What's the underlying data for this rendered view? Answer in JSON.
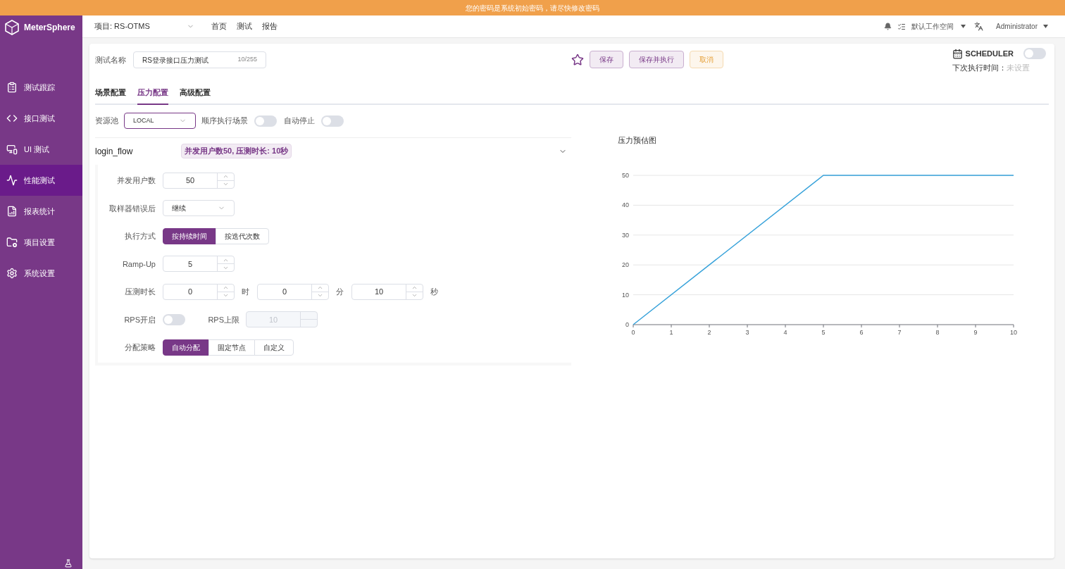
{
  "banner": {
    "text": "您的密码是系统初始密码，请尽快修改密码"
  },
  "sidebar": {
    "logo": "MeterSphere",
    "items": [
      {
        "kind": "track",
        "label": "测试跟踪",
        "selected": false
      },
      {
        "kind": "api",
        "label": "接口测试",
        "selected": false
      },
      {
        "kind": "ui",
        "label": "UI 测试",
        "selected": false
      },
      {
        "kind": "performance",
        "label": "性能测试",
        "selected": true
      },
      {
        "kind": "report",
        "label": "报表统计",
        "selected": false
      },
      {
        "kind": "project",
        "label": "项目设置",
        "selected": false
      },
      {
        "kind": "system",
        "label": "系统设置",
        "selected": false
      }
    ]
  },
  "header": {
    "project": "项目: RS-OTMS",
    "nav": [
      "首页",
      "测试",
      "报告"
    ],
    "workspace": "默认工作空间",
    "user": "Administrator"
  },
  "test": {
    "name_label": "测试名称",
    "name_value": "RS登录接口压力测试",
    "counter": "10/255",
    "starred": false,
    "buttons": [
      {
        "kind": "primary",
        "label": "保存"
      },
      {
        "kind": "primary",
        "label": "保存并执行"
      },
      {
        "kind": "warning",
        "label": "取消"
      }
    ]
  },
  "scheduler": {
    "label": "SCHEDULER",
    "on": false,
    "next_label": "下次执行时间：",
    "next_value": "未设置"
  },
  "tabs": [
    {
      "label": "场景配置",
      "selected": false
    },
    {
      "label": "压力配置",
      "selected": true
    },
    {
      "label": "高级配置",
      "selected": false
    }
  ],
  "pool": {
    "label": "资源池",
    "value": "LOCAL",
    "toggles": [
      {
        "label": "顺序执行场景",
        "on": false
      },
      {
        "label": "自动停止",
        "on": false
      }
    ]
  },
  "scenario": {
    "name": "login_flow",
    "summary": "并发用户数50, 压测时长: 10秒",
    "fields": [
      {
        "kind": "number",
        "label": "并发用户数",
        "value": "50"
      },
      {
        "kind": "select",
        "label": "取样器错误后",
        "value": "继续"
      },
      {
        "kind": "segmented",
        "label": "执行方式",
        "options": [
          {
            "label": "按持续时间",
            "selected": true
          },
          {
            "label": "按迭代次数",
            "selected": false
          }
        ]
      },
      {
        "kind": "number",
        "label": "Ramp-Up",
        "value": "5"
      },
      {
        "kind": "duration",
        "label": "压测时长",
        "parts": [
          {
            "value": "0",
            "unit": "时"
          },
          {
            "value": "0",
            "unit": "分"
          },
          {
            "value": "10",
            "unit": "秒"
          }
        ]
      },
      {
        "kind": "rps",
        "label": "RPS开启",
        "on": false,
        "limit_label": "RPS上限",
        "limit_value": "10"
      },
      {
        "kind": "segmented",
        "label": "分配策略",
        "options": [
          {
            "label": "自动分配",
            "selected": true
          },
          {
            "label": "固定节点",
            "selected": false
          },
          {
            "label": "自定义",
            "selected": false
          }
        ]
      }
    ]
  },
  "chart": {
    "chart_data": {
      "type": "line",
      "title": "压力预估图",
      "grid": true,
      "x": [
        0,
        5,
        10
      ],
      "series": [
        {
          "color": "#37a2da",
          "values": [
            0,
            50,
            50
          ]
        }
      ],
      "xlim": [
        0,
        10
      ],
      "ylim": [
        0,
        50
      ],
      "xticks": [
        0,
        1,
        2,
        3,
        4,
        5,
        6,
        7,
        8,
        9,
        10
      ],
      "yticks": [
        0,
        10,
        20,
        30,
        40,
        50
      ]
    }
  }
}
